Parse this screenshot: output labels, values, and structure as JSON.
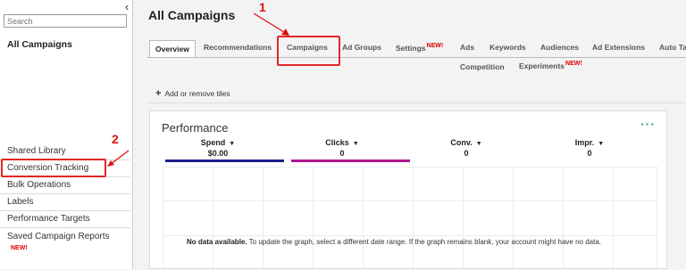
{
  "sidebar": {
    "collapse_icon": "chevron-left-icon",
    "search_placeholder": "Search",
    "title": "All Campaigns",
    "items": [
      {
        "label": "Shared Library"
      },
      {
        "label": "Conversion Tracking"
      },
      {
        "label": "Bulk Operations"
      },
      {
        "label": "Labels"
      },
      {
        "label": "Performance Targets"
      },
      {
        "label": "Saved Campaign Reports",
        "badge": "NEW!"
      }
    ]
  },
  "main": {
    "title": "All Campaigns",
    "tabs": [
      {
        "label": "Overview"
      },
      {
        "label": "Recommendations"
      },
      {
        "label": "Campaigns"
      },
      {
        "label": "Ad Groups"
      },
      {
        "label": "Settings",
        "badge": "NEW!"
      },
      {
        "label": "Ads"
      },
      {
        "label": "Keywords"
      },
      {
        "label": "Audiences"
      },
      {
        "label": "Ad Extensions"
      },
      {
        "label": "Auto Ta"
      },
      {
        "label": "Competition"
      },
      {
        "label": "Experiments",
        "badge": "NEW!"
      }
    ],
    "add_tiles": "Add or remove tiles",
    "performance": {
      "title": "Performance",
      "more_icon": "more-dots-icon",
      "metrics": [
        {
          "label": "Spend",
          "value": "$0.00",
          "color": "#1a1f8c"
        },
        {
          "label": "Clicks",
          "value": "0",
          "color": "#b0168f"
        },
        {
          "label": "Conv.",
          "value": "0",
          "color": ""
        },
        {
          "label": "Impr.",
          "value": "0",
          "color": ""
        }
      ],
      "no_data_bold": "No data available.",
      "no_data_text": "To update the graph, select a different date range. If the graph remains blank, your account might have no data."
    }
  },
  "annotations": {
    "step1": "1",
    "step2": "2",
    "accent": "#e02828"
  }
}
